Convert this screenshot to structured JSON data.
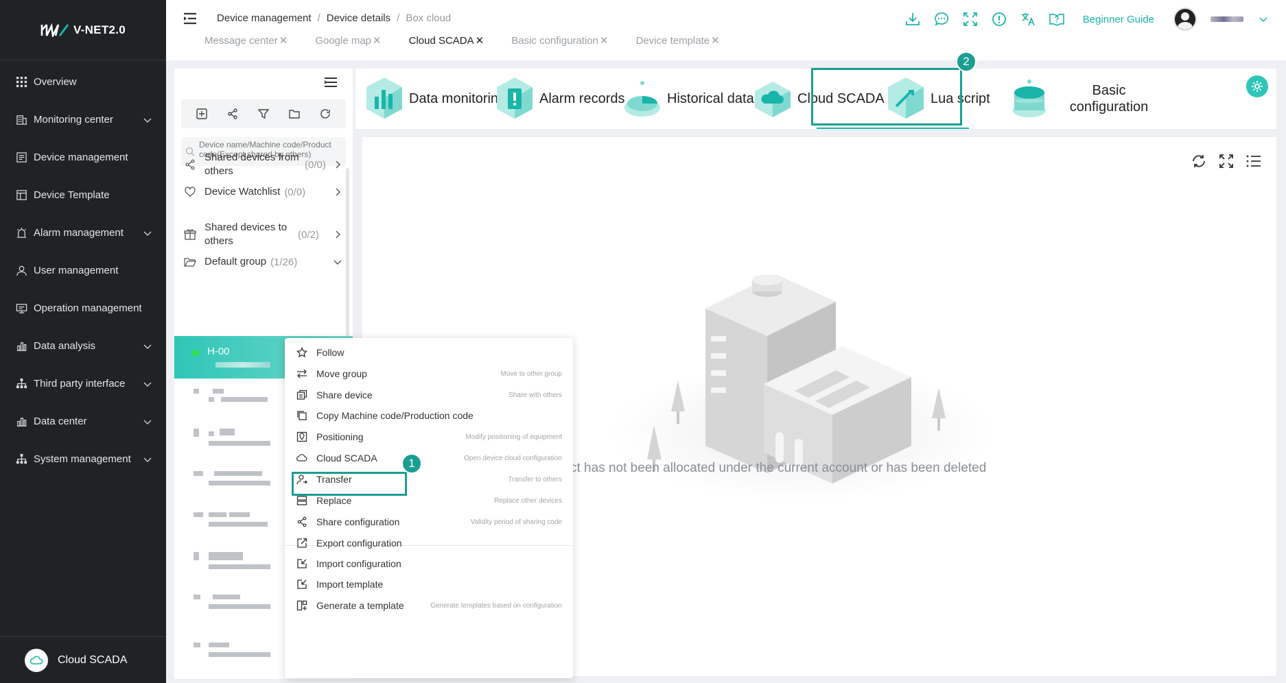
{
  "app": {
    "logo_text": "V-NET2.0"
  },
  "sidebar": {
    "items": [
      {
        "label": "Overview",
        "icon": "grid-icon",
        "expandable": false
      },
      {
        "label": "Monitoring center",
        "icon": "monitor-building-icon",
        "expandable": true
      },
      {
        "label": "Device management",
        "icon": "device-list-icon",
        "expandable": false
      },
      {
        "label": "Device Template",
        "icon": "template-icon",
        "expandable": false
      },
      {
        "label": "Alarm management",
        "icon": "alarm-light-icon",
        "expandable": true
      },
      {
        "label": "User management",
        "icon": "user-icon",
        "expandable": false
      },
      {
        "label": "Operation management",
        "icon": "operation-icon",
        "expandable": false
      },
      {
        "label": "Data analysis",
        "icon": "bar-chart-icon",
        "expandable": true
      },
      {
        "label": "Third party interface",
        "icon": "hierarchy-icon",
        "expandable": true
      },
      {
        "label": "Data center",
        "icon": "bar-chart-icon",
        "expandable": true
      },
      {
        "label": "System management",
        "icon": "hierarchy-icon",
        "expandable": true
      }
    ],
    "footer_label": "Cloud SCADA"
  },
  "header": {
    "breadcrumb": [
      "Device management",
      "Device details",
      "Box cloud"
    ],
    "tabs": [
      {
        "label": "Message center",
        "active": false
      },
      {
        "label": "Google map",
        "active": false
      },
      {
        "label": "Cloud SCADA",
        "active": true
      },
      {
        "label": "Basic configuration",
        "active": false
      },
      {
        "label": "Device template",
        "active": false
      }
    ],
    "tab_close_glyph": "✕",
    "guide_label": "Beginner Guide"
  },
  "device_panel": {
    "search_placeholder": "Device name/Machine code/Product code(Except shared by others)",
    "groups": [
      {
        "label": "Shared devices from others",
        "count": "(0/0)"
      },
      {
        "label": "Device Watchlist",
        "count": "(0/0)"
      },
      {
        "label": "Shared devices to others",
        "count": "(0/2)"
      },
      {
        "label": "Default group",
        "count": "(1/26)"
      }
    ],
    "active_device": {
      "name": "H-00"
    }
  },
  "context_menu": {
    "items": [
      {
        "label": "Follow",
        "hint": "",
        "icon": "star-icon"
      },
      {
        "label": "Move group",
        "hint": "Move to other group",
        "icon": "move-arrows-icon"
      },
      {
        "label": "Share device",
        "hint": "Share with others",
        "icon": "share-device-icon"
      },
      {
        "label": "Copy Machine code/Production code",
        "hint": "",
        "icon": "copy-icon"
      },
      {
        "label": "Positioning",
        "hint": "Modify positioning of equipment",
        "icon": "map-pin-icon"
      },
      {
        "label": "Cloud SCADA",
        "hint": "Open device cloud configuration",
        "icon": "cloud-icon"
      },
      {
        "label": "Transfer",
        "hint": "Transfer to others",
        "icon": "transfer-user-icon"
      },
      {
        "label": "Replace",
        "hint": "Replace other devices",
        "icon": "replace-icon"
      },
      {
        "label": "Share configuration",
        "hint": "Validity period of sharing code",
        "icon": "share-icon"
      },
      {
        "label": "Export configuration",
        "hint": "",
        "icon": "export-icon"
      },
      {
        "label": "Import configuration",
        "hint": "",
        "icon": "import-icon"
      },
      {
        "label": "Import template",
        "hint": "",
        "icon": "import-icon"
      },
      {
        "label": "Generate a template",
        "hint": "Generate templates based on configuration",
        "icon": "generate-template-icon"
      }
    ]
  },
  "feature_tabs": [
    {
      "label": "Data monitoring",
      "icon": "data-monitoring-icon"
    },
    {
      "label": "Alarm records",
      "icon": "alarm-records-icon"
    },
    {
      "label": "Historical data",
      "icon": "historical-data-icon"
    },
    {
      "label": "Cloud SCADA",
      "icon": "cloud-scada-icon"
    },
    {
      "label": "Lua script",
      "icon": "lua-script-icon"
    },
    {
      "label": "Basic configuration",
      "icon": "basic-config-icon"
    }
  ],
  "steps": {
    "one": "1",
    "two": "2"
  },
  "content": {
    "empty_message": "The project has not been allocated under the current account or has been deleted"
  },
  "colors": {
    "accent": "#19b5a9",
    "highlight": "#1a9e92",
    "sidebar_bg": "#1f2326"
  }
}
